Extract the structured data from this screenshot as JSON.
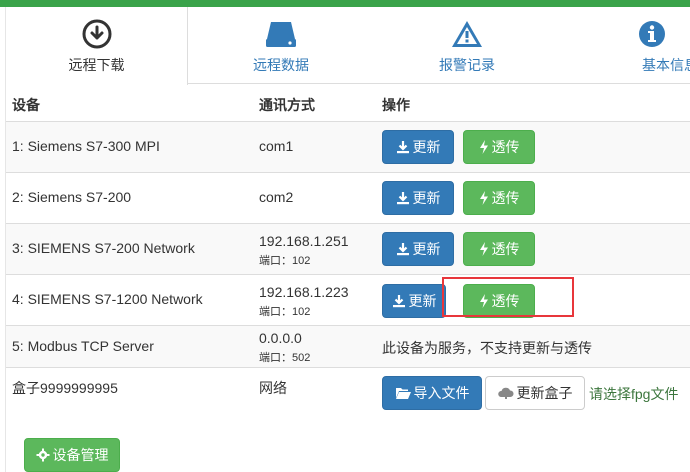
{
  "tabs": [
    {
      "label": "远程下载",
      "icon": "download-circle-icon",
      "active": true
    },
    {
      "label": "远程数据",
      "icon": "hard-drive-icon",
      "active": false
    },
    {
      "label": "报警记录",
      "icon": "warning-triangle-icon",
      "active": false
    },
    {
      "label": "基本信息",
      "icon": "info-circle-icon",
      "active": false
    }
  ],
  "table": {
    "headers": {
      "device": "设备",
      "comm": "通讯方式",
      "action": "操作"
    },
    "port_label": "端口：",
    "rows": [
      {
        "device": "1: Siemens S7-300 MPI",
        "comm": "com1",
        "port": "",
        "update": "更新",
        "pass": "透传"
      },
      {
        "device": "2: Siemens S7-200",
        "comm": "com2",
        "port": "",
        "update": "更新",
        "pass": "透传"
      },
      {
        "device": "3: SIEMENS S7-200 Network",
        "comm": "192.168.1.251",
        "port": "端口：102",
        "update": "更新",
        "pass": "透传"
      },
      {
        "device": "4: SIEMENS S7-1200 Network",
        "comm": "192.168.1.223",
        "port": "端口：102",
        "update": "更新",
        "pass": "透传"
      },
      {
        "device": "5: Modbus TCP Server",
        "comm": "0.0.0.0",
        "port": "端口：502",
        "note": "此设备为服务，不支持更新与透传"
      },
      {
        "device": "盒子9999999995",
        "comm": "网络",
        "import": "导入文件",
        "update_box": "更新盒子",
        "hint": "请选择fpg文件"
      }
    ]
  },
  "footer": {
    "device_mgmt": "设备管理"
  },
  "colors": {
    "blue": "#337ab7",
    "green": "#5cb85c",
    "highlight": "#e8363b",
    "topbar": "#3aa34a"
  }
}
